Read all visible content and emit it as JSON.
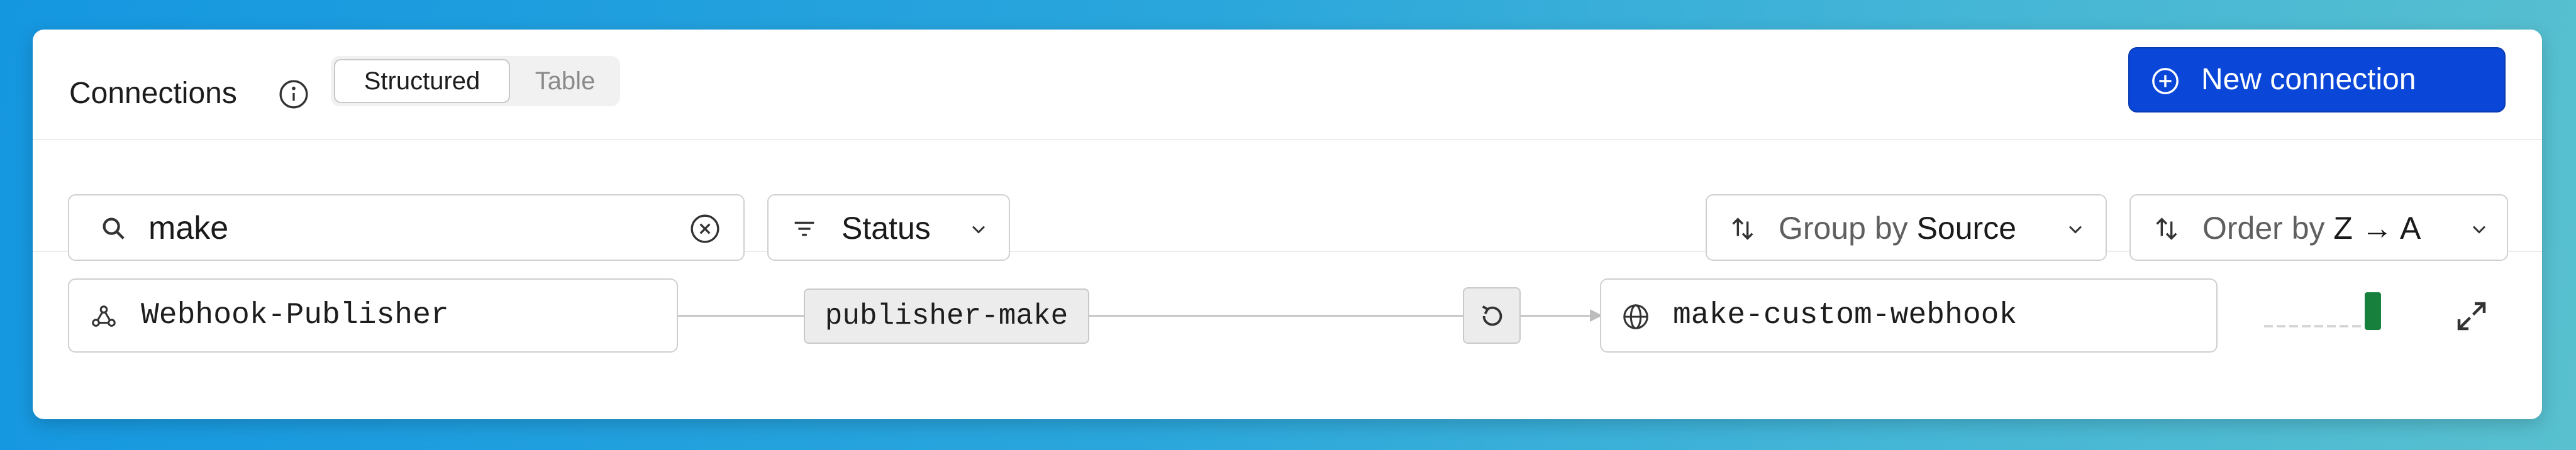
{
  "header": {
    "title": "Connections",
    "view_toggle": {
      "options": [
        "Structured",
        "Table"
      ],
      "selected": "Structured"
    },
    "new_connection_label": "New connection"
  },
  "toolbar": {
    "search": {
      "value": "make",
      "placeholder": ""
    },
    "status_filter_label": "Status",
    "group_by": {
      "prefix": "Group by",
      "value": "Source"
    },
    "order_by": {
      "prefix": "Order by",
      "value": "Z → A"
    }
  },
  "connections": [
    {
      "source": "Webhook-Publisher",
      "connection": "publisher-make",
      "destination": "make-custom-webhook",
      "activity": [
        0,
        0,
        0,
        0,
        0,
        0,
        0,
        0,
        1
      ]
    }
  ],
  "colors": {
    "accent": "#0a47d8",
    "activity_success": "#17803d",
    "activity_idle": "#d6d6d6"
  }
}
